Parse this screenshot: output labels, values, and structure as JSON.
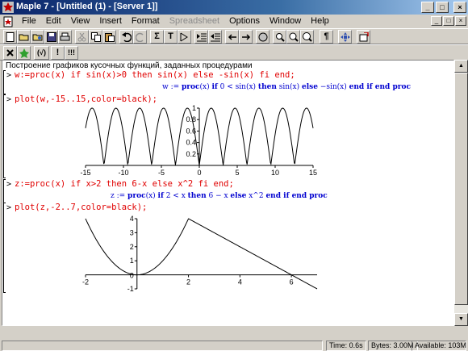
{
  "window": {
    "title": "Maple 7  - [Untitled (1) - [Server 1]]",
    "controls": {
      "minimize": "_",
      "maximize": "□",
      "close": "×"
    }
  },
  "menu": {
    "items": [
      "File",
      "Edit",
      "View",
      "Insert",
      "Format",
      "Spreadsheet",
      "Options",
      "Window",
      "Help"
    ],
    "disabled": [
      "Spreadsheet"
    ]
  },
  "toolbar": {
    "icons": [
      "new-icon",
      "open-icon",
      "open-url-icon",
      "save-icon",
      "print-icon",
      "cut-icon",
      "copy-icon",
      "paste-icon",
      "undo-icon",
      "redo-icon",
      "sigma-icon",
      "text-icon",
      "input-icon",
      "indent-icon",
      "outdent-icon",
      "back-icon",
      "forward-icon",
      "stop-icon",
      "zoom-100-icon",
      "zoom-150-icon",
      "zoom-200-icon",
      "pilcrow-icon",
      "expand-icon",
      "restart-icon"
    ],
    "sigma": "Σ",
    "text": "T",
    "pilcrow": "¶",
    "row2": {
      "text_input": "(√)",
      "exclaim": "!",
      "exclaim_all": "!!!"
    }
  },
  "worksheet": {
    "header": "Построение графиков кусочных функций, заданных процедурами",
    "prompt": ">",
    "input1": "w:=proc(x) if sin(x)>0 then sin(x) else -sin(x) fi end;",
    "output1": {
      "lhs": "w := ",
      "proc": "proc",
      "arg": "(x) ",
      "if": "if",
      "cond": " 0 < sin(x) ",
      "then": "then",
      "t": " sin(x) ",
      "else": "else",
      "e": " −sin(x) ",
      "end": "end if end proc"
    },
    "input2": "plot(w,-15..15,color=black);",
    "input3": "z:=proc(x) if x>2 then 6-x else x^2 fi end;",
    "output3": {
      "lhs": "z := ",
      "proc": "proc",
      "arg": "(x) ",
      "if": "if",
      "cond": " 2 < x ",
      "then": "then",
      "t": " 6 − x ",
      "else": "else",
      "e": " x^2 ",
      "end": "end if end proc"
    },
    "input4": "plot(z,-2..7,color=black);"
  },
  "chart_data": [
    {
      "type": "line",
      "function": "|sin(x)|",
      "x_range": [
        -15,
        15
      ],
      "ylim": [
        0,
        1
      ],
      "x_ticks": [
        "-15",
        "-10",
        "-5",
        "0",
        "5",
        "10",
        "15"
      ],
      "y_ticks": [
        "0.2",
        "0.4",
        "0.6",
        "0.8",
        "1"
      ],
      "color": "#000000",
      "grid": false
    },
    {
      "type": "line",
      "function": "x^2 for x<=2, 6-x for x>2",
      "x_range": [
        -2,
        7
      ],
      "ylim": [
        -1,
        4
      ],
      "x_ticks": [
        "-2",
        "2",
        "4",
        "6"
      ],
      "y_ticks": [
        "-1",
        "1",
        "2",
        "3",
        "4"
      ],
      "origin_label": "0",
      "color": "#000000",
      "grid": false
    }
  ],
  "status": {
    "time": "Time:  0.6s",
    "bytes": "Bytes: 3.00M",
    "available": "Available: 103M"
  }
}
